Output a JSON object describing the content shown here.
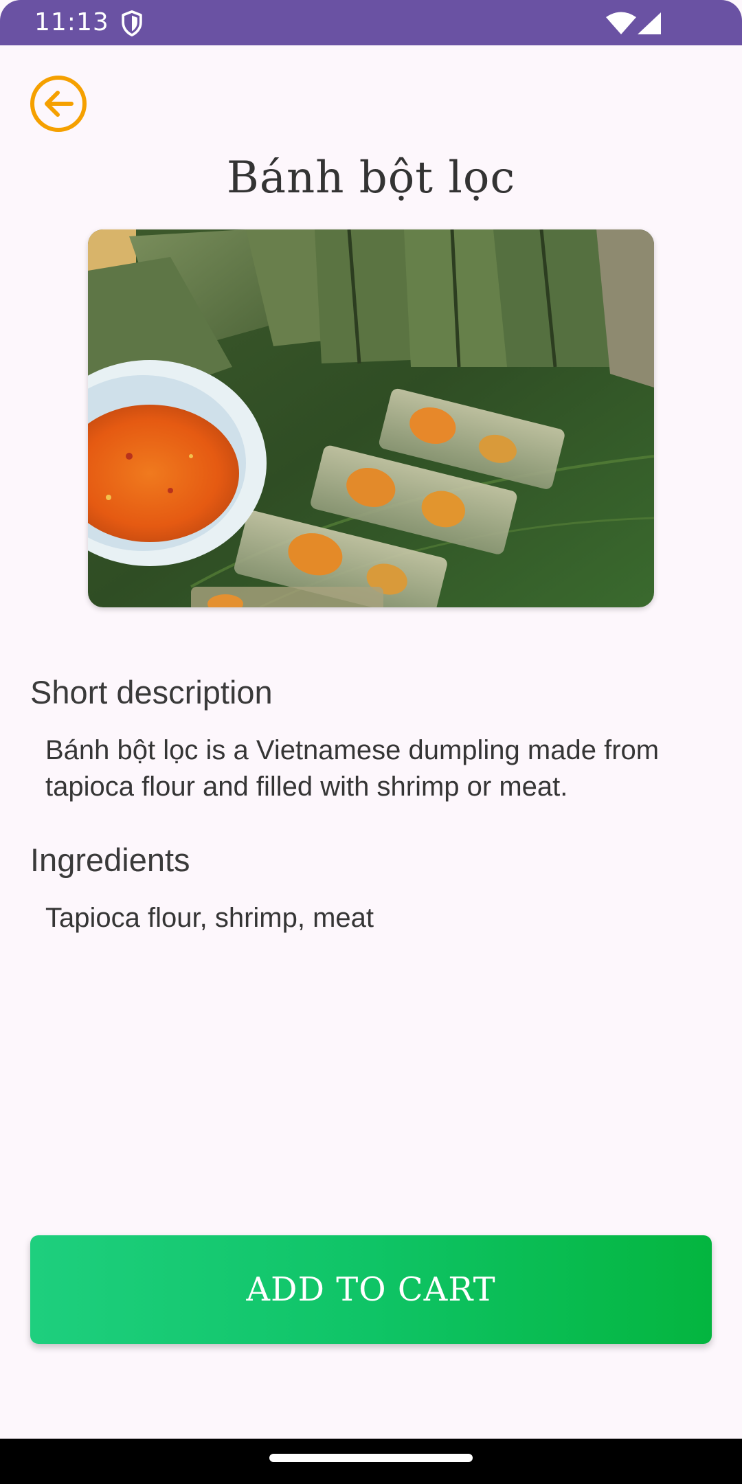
{
  "status_bar": {
    "time": "11:13",
    "icons": [
      "shield-icon",
      "wifi-icon",
      "signal-icon"
    ]
  },
  "header": {
    "back_icon": "arrow-left-circle-icon",
    "title": "Bánh bột lọc"
  },
  "image": {
    "alt": "Bánh bột lọc"
  },
  "description": {
    "heading": "Short description",
    "body": "Bánh bột lọc is a Vietnamese dumpling made from tapioca flour and filled with shrimp or meat."
  },
  "ingredients": {
    "heading": "Ingredients",
    "body": "Tapioca flour, shrimp, meat"
  },
  "actions": {
    "add_to_cart_label": "ADD TO CART"
  },
  "colors": {
    "status_bar": "#6a52a3",
    "accent_orange": "#f5a000",
    "button_green_start": "#1ecf7e",
    "button_green_end": "#04b53f",
    "background": "#fdf7fc"
  }
}
